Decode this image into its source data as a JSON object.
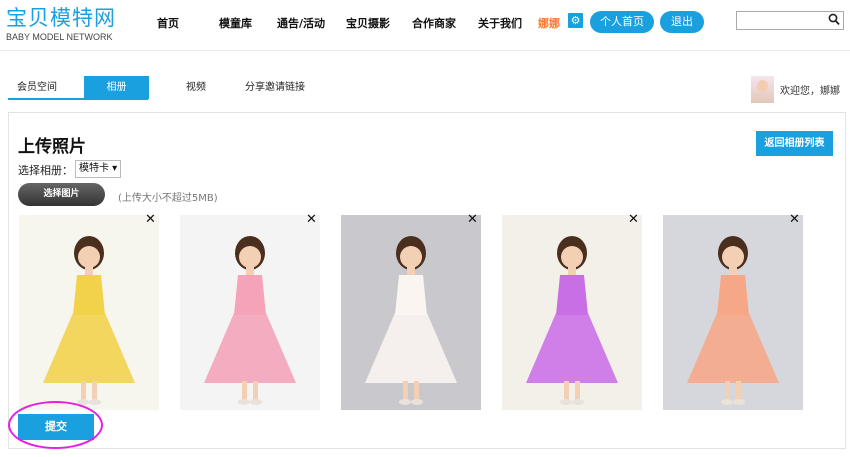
{
  "logo": {
    "name_cn": "宝贝模特网",
    "name_en": "BABY MODEL NETWORK"
  },
  "nav": [
    "首页",
    "模童库",
    "通告/活动",
    "宝贝摄影",
    "合作商家",
    "关于我们"
  ],
  "user": {
    "name": "娜娜",
    "profile_btn": "个人首页",
    "logout_btn": "退出"
  },
  "search": {
    "placeholder": ""
  },
  "subnav": {
    "tabs": [
      "会员空间",
      "相册",
      "视频",
      "分享邀请链接"
    ],
    "active": "相册",
    "welcome": "欢迎您，娜娜"
  },
  "upload": {
    "title": "上传照片",
    "back_btn": "返回相册列表",
    "album_label": "选择相册：",
    "album_value": "模特卡 ▾",
    "choose_btn": "选择图片",
    "hint": "(上传大小不超过5MB)",
    "close_symbol": "✕",
    "submit_btn": "提交"
  },
  "photos": [
    {
      "dress": "#f2d24a",
      "bg": "#f7f6ee"
    },
    {
      "dress": "#f4a3b8",
      "bg": "#f4f4f4"
    },
    {
      "dress": "#fbf5f2",
      "bg": "#c9c9cd"
    },
    {
      "dress": "#c96fe6",
      "bg": "#f3efe9"
    },
    {
      "dress": "#f6a788",
      "bg": "#d6d7dc"
    }
  ],
  "colors": {
    "accent": "#1a9fdf",
    "username": "#ff7a2a",
    "highlight": "#e61ee8"
  }
}
